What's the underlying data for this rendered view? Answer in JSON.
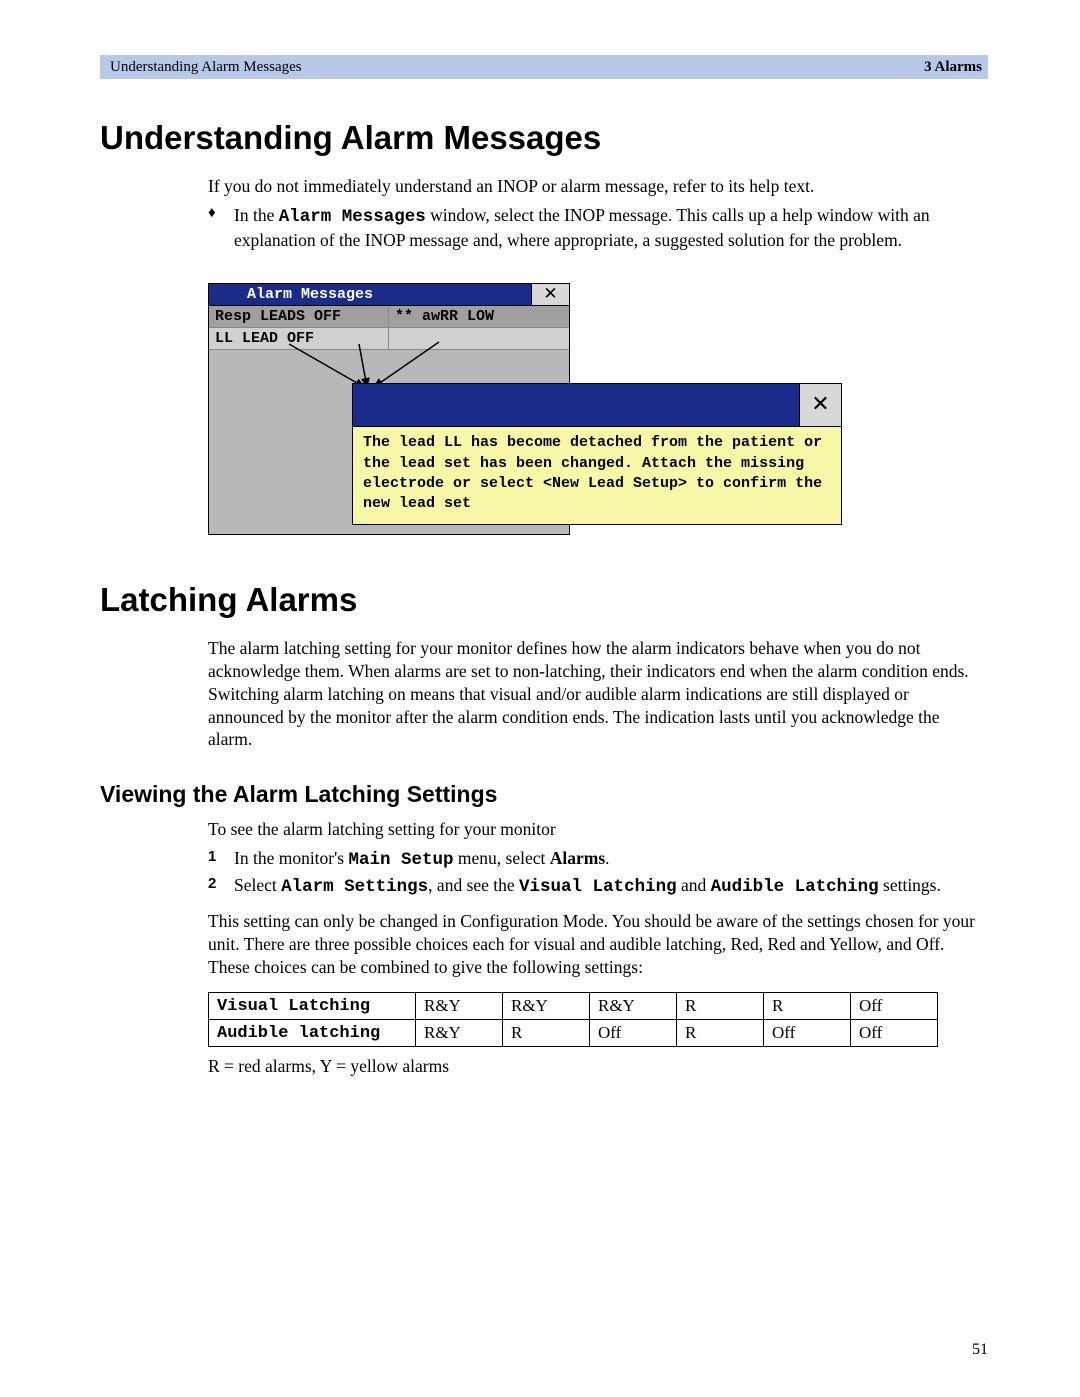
{
  "header": {
    "left": "Understanding Alarm Messages",
    "right": "3 Alarms"
  },
  "h1a": "Understanding Alarm Messages",
  "intro": "If you do not immediately understand an INOP or alarm message, refer to its help text.",
  "bullet_prefix": "In the ",
  "bullet_mono": "Alarm Messages",
  "bullet_suffix": " window, select the INOP message. This calls up a help window with an explanation of the INOP message and, where appropriate, a suggested solution for the problem.",
  "win1": {
    "title": "Alarm Messages",
    "close": "✕",
    "row1_left": "Resp LEADS OFF",
    "row1_right": "** awRR LOW",
    "row2_left": "LL LEAD OFF"
  },
  "win2": {
    "close": "✕",
    "body": "The lead LL has become detached from the patient or the lead set has been changed. Attach the missing electrode or select <New Lead Setup> to confirm the new lead set"
  },
  "h1b": "Latching Alarms",
  "latch_para": "The alarm latching setting for your monitor defines how the alarm indicators behave when you do not acknowledge them. When alarms are set to non-latching, their indicators end when the alarm condition ends. Switching alarm latching on means that visual and/or audible alarm indications are still displayed or announced by the monitor after the alarm condition ends. The indication lasts until you acknowledge the alarm.",
  "h2a": "Viewing the Alarm Latching Settings",
  "view_intro": "To see the alarm latching setting for your monitor",
  "step1_a": "In the monitor's ",
  "step1_m1": "Main Setup",
  "step1_b": " menu, select ",
  "step1_m2": "Alarms",
  "step1_c": ".",
  "step2_a": "Select ",
  "step2_m1": "Alarm Settings",
  "step2_b": ", and see the ",
  "step2_m2": "Visual Latching",
  "step2_c": " and ",
  "step2_m3": "Audible Latching",
  "step2_d": " settings.",
  "config_para": "This setting can only be changed in Configuration Mode. You should be aware of the settings chosen for your unit. There are three possible choices each for visual and audible latching, Red, Red and Yellow, and Off. These choices can be combined to give the following settings:",
  "table": {
    "row1_label": "Visual Latching",
    "row2_label": "Audible latching",
    "row1": [
      "R&Y",
      "R&Y",
      "R&Y",
      "R",
      "R",
      "Off"
    ],
    "row2": [
      "R&Y",
      "R",
      "Off",
      "R",
      "Off",
      "Off"
    ]
  },
  "legend": "R = red alarms, Y = yellow alarms",
  "page": "51"
}
